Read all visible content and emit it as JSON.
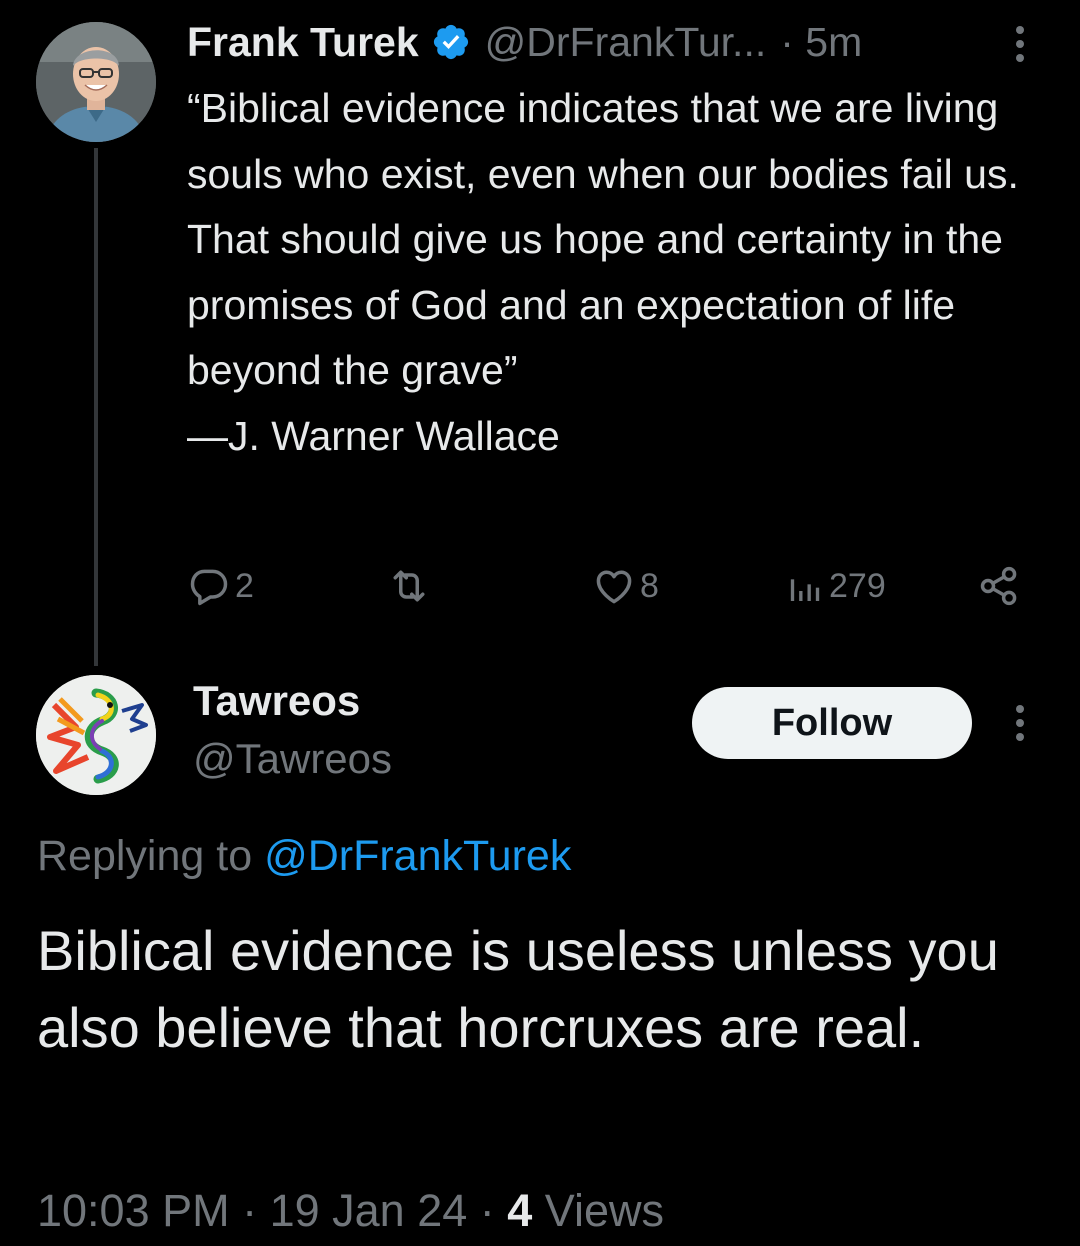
{
  "original_tweet": {
    "author_name": "Frank Turek",
    "handle_truncated": "@DrFrankTur...",
    "time_ago": "· 5m",
    "text": "“Biblical evidence indicates that we are living souls who exist, even when our bodies fail us. That should give us hope and certainty in the promises of God and an expectation of life beyond the grave”\n—J. Warner Wallace",
    "verified_icon": "verified-badge-icon",
    "verified_color": "#1d9bf0",
    "actions": {
      "replies": "2",
      "retweets": "",
      "likes": "8",
      "views": "279"
    }
  },
  "reply_tweet": {
    "author_name": "Tawreos",
    "handle": "@Tawreos",
    "follow_label": "Follow",
    "replying_prefix": "Replying to ",
    "replying_mention": "@DrFrankTurek",
    "text": "Biblical evidence is useless unless you also believe that horcruxes are real.",
    "timestamp": "10:03 PM · 19 Jan 24 · ",
    "views_count": "4",
    "views_label": " Views"
  },
  "colors": {
    "background": "#000000",
    "primary_text": "#e7e9ea",
    "secondary_text": "#71767b",
    "link": "#1d9bf0",
    "thread_line": "#333639",
    "follow_button": "#eff3f4"
  }
}
